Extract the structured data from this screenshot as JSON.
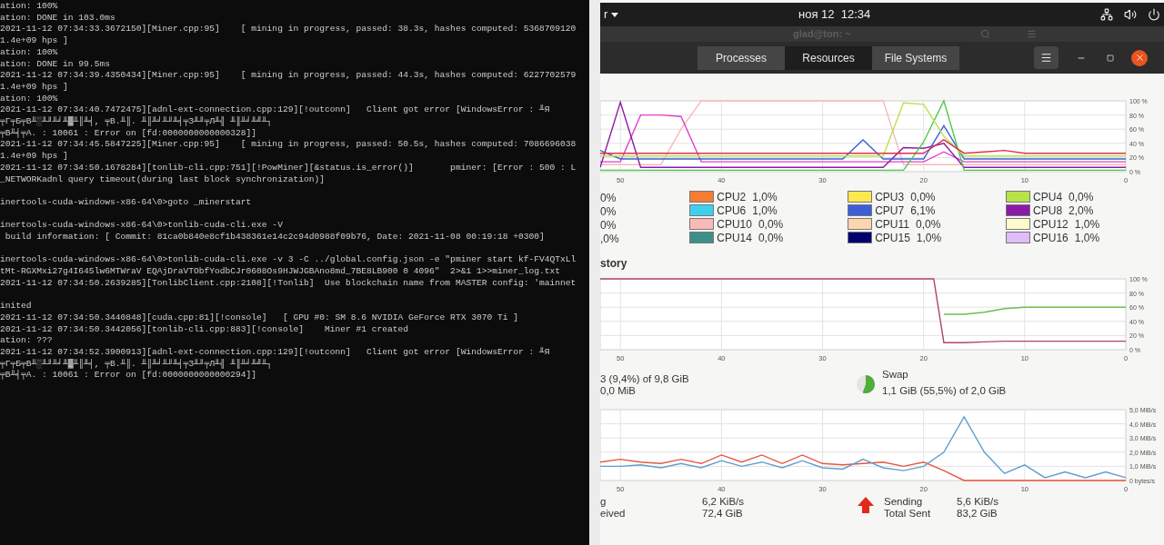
{
  "terminal": {
    "lines": [
      {
        "text": "ation: 100%",
        "blank_before": false
      },
      {
        "text": "ation: DONE in 103.0ms",
        "blank_before": false
      },
      {
        "text": "2021-11-12 07:34:33.3672150][Miner.cpp:95]    [ mining in progress, passed: 38.3s, hashes computed: 5368709120",
        "blank_before": false
      },
      {
        "text": "1.4e+09 hps ]",
        "blank_before": false
      },
      {
        "text": "ation: 100%",
        "blank_before": false
      },
      {
        "text": "ation: DONE in 99.5ms",
        "blank_before": false
      },
      {
        "text": "2021-11-12 07:34:39.4350434][Miner.cpp:95]    [ mining in progress, passed: 44.3s, hashes computed: 6227702579",
        "blank_before": false
      },
      {
        "text": "1.4e+09 hps ]",
        "blank_before": false
      },
      {
        "text": "ation: 100%",
        "blank_before": false
      },
      {
        "text": "2021-11-12 07:34:40.7472475][adnl-ext-connection.cpp:129][!outconn]   Client got error [WindowsError : ╨Я",
        "blank_before": false
      },
      {
        "text": "╤Г╤Б╤В╨░╨╜╨╛╨▓╨║╨╡, ╤В.╨║. ╨║╨╛╨╜╨╡╤З╨╜╤Л╨╣ ╨║╨╛╨╝╨┐",
        "blank_before": false
      },
      {
        "text": "╤В╨╡╤А. : 10061 : Error on [fd:0000000000000328]]",
        "blank_before": false
      },
      {
        "text": "2021-11-12 07:34:45.5847225][Miner.cpp:95]    [ mining in progress, passed: 50.5s, hashes computed: 7086696038",
        "blank_before": false
      },
      {
        "text": "1.4e+09 hps ]",
        "blank_before": false
      },
      {
        "text": "2021-11-12 07:34:50.1678284][tonlib-cli.cpp:751][!PowMiner][&status.is_error()]       pminer: [Error : 500 : L",
        "blank_before": false
      },
      {
        "text": "_NETWORKadnl query timeout(during last block synchronization)]",
        "blank_before": false
      },
      {
        "text": "inertools-cuda-windows-x86-64\\0>goto _minerstart",
        "blank_before": true
      },
      {
        "text": "inertools-cuda-windows-x86-64\\0>tonlib-cuda-cli.exe -V",
        "blank_before": true
      },
      {
        "text": " build information: [ Commit: 81ca0b840e8cf1b438361e14c2c94d0988f09b76, Date: 2021-11-08 00:19:18 +0300]",
        "blank_before": false
      },
      {
        "text": "inertools-cuda-windows-x86-64\\0>tonlib-cuda-cli.exe -v 3 -C ../global.config.json -e \"pminer start kf-FV4QTxLl",
        "blank_before": true
      },
      {
        "text": "tMt-RGXMxi27g4I645lw6MTWraV EQAjDraVTObfYodbCJr0608Os9HJWJGBAno8md_7BE8LB900 0 4096\"  2>&1 1>>miner_log.txt",
        "blank_before": false
      },
      {
        "text": "2021-11-12 07:34:50.2639285][TonlibClient.cpp:2108][!Tonlib]  Use blockchain name from MASTER config: 'mainnet",
        "blank_before": false
      },
      {
        "text": "inited",
        "blank_before": true
      },
      {
        "text": "2021-11-12 07:34:50.3440848][cuda.cpp:81][!console]   [ GPU #0: SM 8.6 NVIDIA GeForce RTX 3070 Ti ]",
        "blank_before": false
      },
      {
        "text": "2021-11-12 07:34:50.3442056][tonlib-cli.cpp:883][!console]    Miner #1 created",
        "blank_before": false
      },
      {
        "text": "ation: ???",
        "blank_before": false
      },
      {
        "text": "2021-11-12 07:34:52.3900913][adnl-ext-connection.cpp:129][!outconn]   Client got error [WindowsError : ╨Я",
        "blank_before": false
      },
      {
        "text": "╤Г╤Б╤В╨░╨╜╨╛╨▓╨║╨╡, ╤В.╨║. ╨║╨╛╨╜╨╡╤З╨╜╤Л╨╣ ╨║╨╛╨╝╨┐",
        "blank_before": false
      },
      {
        "text": "╤В╨╡╤А. : 10061 : Error on [fd:0000000000000294]]",
        "blank_before": false
      }
    ]
  },
  "top_bar": {
    "app_menu": "r",
    "clock": "ноя 12  12:34"
  },
  "background_window": {
    "title": "glad@ton: ~"
  },
  "header": {
    "tabs": [
      {
        "label": "Processes",
        "selected": false
      },
      {
        "label": "Resources",
        "selected": true
      },
      {
        "label": "File Systems",
        "selected": false
      }
    ]
  },
  "cpu": {
    "chart_data": {
      "type": "line",
      "x": [
        52,
        50,
        48,
        46,
        44,
        42,
        40,
        38,
        36,
        34,
        32,
        30,
        28,
        26,
        24,
        22,
        20,
        18,
        16,
        14,
        12,
        10,
        8,
        6,
        4,
        2,
        0
      ],
      "xlim": [
        52,
        0
      ],
      "ylim": [
        0,
        100
      ],
      "xticks": [
        50,
        40,
        30,
        20,
        10,
        0
      ],
      "yticks": [
        {
          "value": 100,
          "label": "100 %"
        },
        {
          "value": 80,
          "label": "80 %"
        },
        {
          "value": 60,
          "label": "60 %"
        },
        {
          "value": 40,
          "label": "40 %"
        },
        {
          "value": 20,
          "label": "20 %"
        },
        {
          "value": 0,
          "label": "0 %"
        }
      ],
      "series": [
        {
          "color": "#f9b9b9",
          "values": [
            10,
            10,
            10,
            10,
            60,
            100,
            100,
            100,
            100,
            100,
            100,
            100,
            100,
            100,
            100,
            10,
            10,
            10,
            10,
            10,
            10,
            10,
            10,
            10,
            10,
            10,
            10
          ]
        },
        {
          "color": "#e040d0",
          "values": [
            14,
            14,
            80,
            80,
            78,
            14,
            14,
            14,
            14,
            14,
            14,
            14,
            14,
            14,
            14,
            14,
            14,
            28,
            14,
            14,
            14,
            14,
            14,
            14,
            14,
            14,
            14
          ]
        },
        {
          "color": "#8c1aa8",
          "values": [
            6,
            98,
            6,
            6,
            6,
            6,
            6,
            6,
            6,
            6,
            6,
            6,
            6,
            6,
            6,
            34,
            33,
            40,
            6,
            6,
            6,
            6,
            6,
            6,
            6,
            6,
            6
          ]
        },
        {
          "color": "#3d5fd6",
          "values": [
            30,
            18,
            18,
            18,
            18,
            18,
            18,
            18,
            18,
            18,
            18,
            18,
            18,
            45,
            18,
            18,
            18,
            65,
            18,
            18,
            18,
            18,
            18,
            18,
            18,
            18,
            18
          ]
        },
        {
          "color": "#4ec94e",
          "values": [
            2,
            2,
            2,
            2,
            2,
            2,
            2,
            2,
            2,
            2,
            2,
            2,
            2,
            2,
            2,
            2,
            42,
            100,
            2,
            2,
            2,
            2,
            2,
            2,
            2,
            2,
            2
          ]
        },
        {
          "color": "#b8e24a",
          "values": [
            22,
            22,
            22,
            22,
            22,
            22,
            22,
            22,
            22,
            22,
            22,
            22,
            22,
            22,
            22,
            97,
            95,
            50,
            22,
            22,
            22,
            22,
            22,
            22,
            22,
            22,
            22
          ]
        },
        {
          "color": "#e0304a",
          "values": [
            26,
            26,
            26,
            26,
            26,
            26,
            26,
            26,
            26,
            26,
            26,
            26,
            26,
            26,
            26,
            26,
            26,
            45,
            26,
            28,
            30,
            26,
            26,
            26,
            26,
            26,
            26
          ]
        }
      ],
      "grid": true
    },
    "legend_cut": [
      "0%",
      "0%",
      "0%",
      ",0%"
    ],
    "legend": [
      [
        {
          "label": "CPU2",
          "value": "1,0%",
          "color": "#f57d31"
        },
        {
          "label": "CPU3",
          "value": "0,0%",
          "color": "#fce94f"
        },
        {
          "label": "CPU4",
          "value": "0,0%",
          "color": "#b8e24a"
        }
      ],
      [
        {
          "label": "CPU6",
          "value": "1,0%",
          "color": "#3fd0f0"
        },
        {
          "label": "CPU7",
          "value": "6,1%",
          "color": "#3d5fd6"
        },
        {
          "label": "CPU8",
          "value": "2,0%",
          "color": "#8c1aa8"
        }
      ],
      [
        {
          "label": "CPU10",
          "value": "0,0%",
          "color": "#f9b9b9"
        },
        {
          "label": "CPU11",
          "value": "0,0%",
          "color": "#fdd6b0"
        },
        {
          "label": "CPU12",
          "value": "1,0%",
          "color": "#fffacd"
        }
      ],
      [
        {
          "label": "CPU14",
          "value": "0,0%",
          "color": "#3d9089"
        },
        {
          "label": "CPU15",
          "value": "1,0%",
          "color": "#00006e"
        },
        {
          "label": "CPU16",
          "value": "1,0%",
          "color": "#e0bcf9"
        }
      ]
    ]
  },
  "memory": {
    "title": "story",
    "chart_data": {
      "type": "line",
      "x": [
        52,
        50,
        48,
        46,
        44,
        42,
        40,
        38,
        36,
        34,
        32,
        30,
        28,
        26,
        24,
        22,
        20,
        19,
        18,
        16,
        14,
        12,
        10,
        8,
        6,
        4,
        2,
        0
      ],
      "xlim": [
        52,
        0
      ],
      "ylim": [
        0,
        100
      ],
      "xticks": [
        50,
        40,
        30,
        20,
        10,
        0
      ],
      "yticks": [
        {
          "value": 100,
          "label": "100 %"
        },
        {
          "value": 80,
          "label": "80 %"
        },
        {
          "value": 60,
          "label": "60 %"
        },
        {
          "value": 40,
          "label": "40 %"
        },
        {
          "value": 20,
          "label": "20 %"
        },
        {
          "value": 0,
          "label": "0 %"
        }
      ],
      "series": [
        {
          "color": "#b0456a",
          "values": [
            100,
            100,
            100,
            100,
            100,
            100,
            100,
            100,
            100,
            100,
            100,
            100,
            100,
            100,
            100,
            100,
            100,
            100,
            10,
            10,
            11,
            12,
            12,
            12,
            12,
            12,
            12,
            12
          ]
        },
        {
          "color": "#6dbd4e",
          "values": [
            null,
            null,
            null,
            null,
            null,
            null,
            null,
            null,
            null,
            null,
            null,
            null,
            null,
            null,
            null,
            null,
            null,
            null,
            50,
            50,
            53,
            58,
            60,
            60,
            60,
            60,
            60,
            60
          ]
        }
      ],
      "grid": true
    },
    "memory_text": "3 (9,4%) of 9,8 GiB",
    "cache_text": "0,0 MiB",
    "swap": {
      "label": "Swap",
      "text": "1,1 GiB (55,5%) of 2,0 GiB",
      "level": 0.555
    }
  },
  "network": {
    "chart_data": {
      "type": "line",
      "x": [
        52,
        50,
        48,
        46,
        44,
        42,
        40,
        38,
        36,
        34,
        32,
        30,
        28,
        26,
        24,
        22,
        20,
        18,
        16,
        14,
        12,
        10,
        8,
        6,
        4,
        2,
        0
      ],
      "xlim": [
        52,
        0
      ],
      "ylim": [
        0,
        5
      ],
      "xticks": [
        50,
        40,
        30,
        20,
        10,
        0
      ],
      "yticks": [
        {
          "value": 5,
          "label": "5,0 MiB/s"
        },
        {
          "value": 4,
          "label": "4,0 MiB/s"
        },
        {
          "value": 3,
          "label": "3,0 MiB/s"
        },
        {
          "value": 2,
          "label": "2,0 MiB/s"
        },
        {
          "value": 1,
          "label": "1,0 MiB/s"
        },
        {
          "value": 0,
          "label": "0 bytes/s"
        }
      ],
      "series": [
        {
          "color": "#e8553f",
          "values": [
            1.3,
            1.5,
            1.3,
            1.2,
            1.5,
            1.2,
            1.8,
            1.3,
            1.8,
            1.2,
            1.8,
            1.2,
            1.1,
            1.2,
            1.3,
            1.0,
            1.3,
            0.7,
            0,
            0,
            0,
            0,
            0,
            0,
            0,
            0,
            0
          ]
        },
        {
          "color": "#5f9fd0",
          "values": [
            1.0,
            1.0,
            1.1,
            0.9,
            1.2,
            0.9,
            1.4,
            1.0,
            1.3,
            0.9,
            1.4,
            0.9,
            0.8,
            1.5,
            0.9,
            0.7,
            1.0,
            2.0,
            4.5,
            2.0,
            0.5,
            1.1,
            0.2,
            0.6,
            0.2,
            0.6,
            0.2
          ]
        }
      ],
      "grid": true
    },
    "receiving": {
      "label": "g",
      "rate": "6,2 KiB/s",
      "total_label": "eived",
      "total": "72,4 GiB"
    },
    "sending": {
      "label": "Sending",
      "rate": "5,6 KiB/s",
      "total_label": "Total Sent",
      "total": "83,2 GiB"
    }
  }
}
